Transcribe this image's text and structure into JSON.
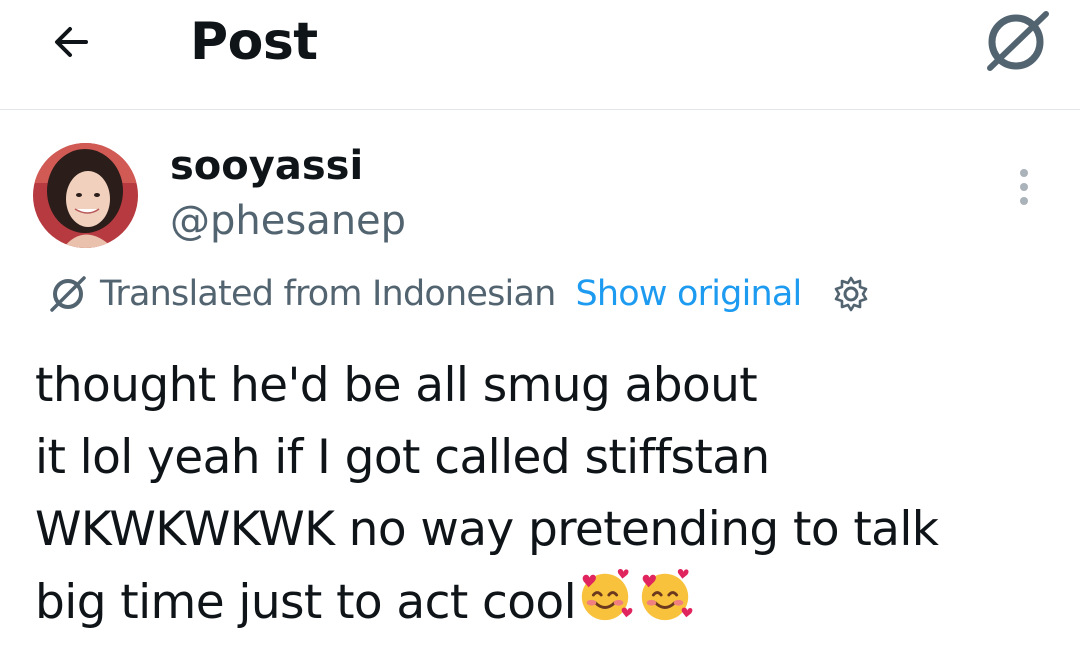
{
  "header": {
    "title": "Post",
    "back_icon": "arrow-left-icon",
    "translate_icon": "translate-globe-icon"
  },
  "post": {
    "author": {
      "display_name": "sooyassi",
      "handle": "@phesanep",
      "avatar": "avatar-photo"
    },
    "more_icon": "more-vertical-icon",
    "translation": {
      "label": "Translated from Indonesian",
      "show_original": "Show original",
      "settings_icon": "gear-icon"
    },
    "text_lines": [
      "thought he'd be all smug about",
      "it lol yeah if I got called stiffstan",
      "WKWKWKWK no way pretending to talk",
      "big time just to act cool"
    ],
    "emojis": [
      "smiling-face-with-hearts-emoji",
      "smiling-face-with-hearts-emoji"
    ]
  },
  "colors": {
    "text": "#0f1419",
    "secondary": "#536471",
    "link": "#1d9bf0",
    "divider": "#e3e6e8"
  }
}
